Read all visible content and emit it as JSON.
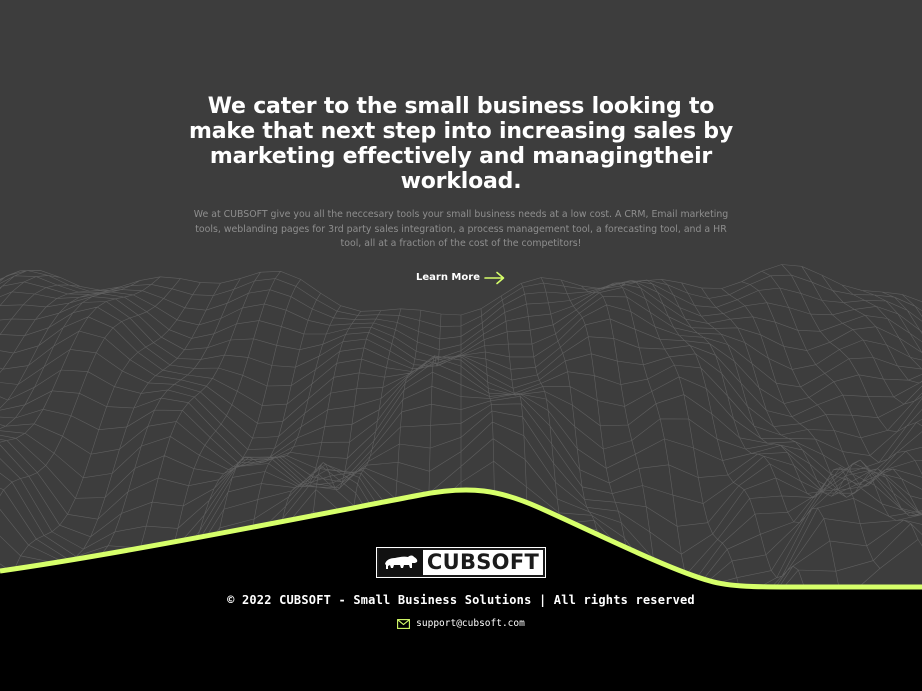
{
  "hero": {
    "title": "We cater to the small business looking to make that next step into increasing sales by marketing effectively and managingtheir workload.",
    "description": "We at CUBSOFT give you all the neccesary tools your small business needs at a low cost. A CRM, Email marketing tools, weblanding pages for 3rd party sales integration, a process management tool, a forecasting tool, and a HR tool, all at a fraction of the cost of the competitors!",
    "cta_label": "Learn More",
    "cta_icon": "arrow-right-icon"
  },
  "footer": {
    "logo_text": "CUBSOFT",
    "logo_icon": "bear-icon",
    "copyright": "© 2022 CUBSOFT - Small Business Solutions | All rights reserved",
    "email": "support@cubsoft.com",
    "email_icon": "envelope-icon"
  },
  "colors": {
    "background": "#3d3d3d",
    "accent": "#d6ff6a",
    "footer": "#000000",
    "wireframe": "#8a8a8a"
  }
}
